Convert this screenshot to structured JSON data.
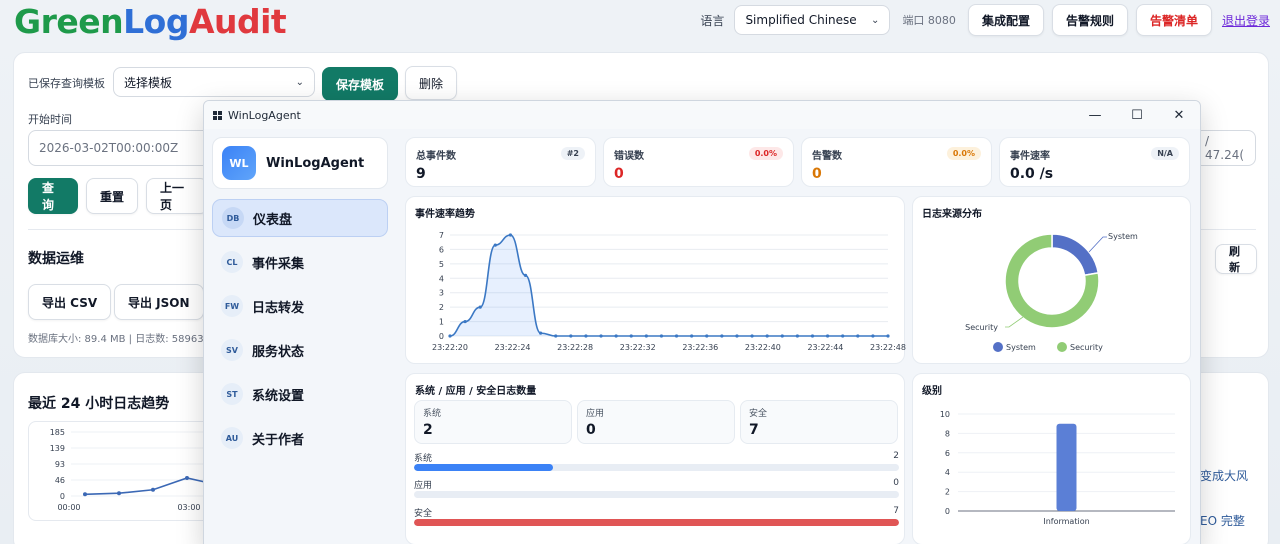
{
  "app": {
    "logo_part1": "Green",
    "logo_part2": "Log",
    "logo_part3": "Audit",
    "colors": {
      "green": "#1e9a4a",
      "blue": "#2f6fd6",
      "red": "#e0393e",
      "primary": "#127a66"
    }
  },
  "topbar": {
    "language_label": "语言",
    "language_value": "Simplified Chinese",
    "port": "端口 8080",
    "integration_button": "集成配置",
    "alert_rules_button": "告警规则",
    "alert_list_button": "告警清单",
    "logout_link": "退出登录"
  },
  "query_panel": {
    "saved_template_label": "已保存查询模板",
    "template_select": "选择模板",
    "save_template_button": "保存模板",
    "delete_button": "删除",
    "start_time_label": "开始时间",
    "start_time_value": "2026-03-02T00:00:00Z",
    "right_clip_value": "/ 47.24(",
    "query_button": "查询",
    "reset_button": "重置",
    "prev_button": "上一页"
  },
  "ops_panel": {
    "title": "数据运维",
    "export_csv_button": "导出 CSV",
    "export_json_button": "导出 JSON",
    "db_info": "数据库大小: 89.4 MB | 日志数: 58963",
    "refresh_button": "刷新"
  },
  "trend_panel": {
    "title": "最近 24 小时日志趋势",
    "y_ticks": [
      "185",
      "139",
      "93",
      "46",
      "0"
    ],
    "x_ticks": [
      "00:00",
      "03:00"
    ],
    "values": [
      5,
      8,
      18,
      52,
      30
    ],
    "right_text_1": "变成大风",
    "right_text_2": "EO 完整"
  },
  "window": {
    "title": "WinLogAgent",
    "minimize": "—",
    "maximize": "☐",
    "close": "✕"
  },
  "sidebar": {
    "brand_badge": "WL",
    "brand_name": "WinLogAgent",
    "items": [
      {
        "code": "DB",
        "label": "仪表盘",
        "active": true
      },
      {
        "code": "CL",
        "label": "事件采集"
      },
      {
        "code": "FW",
        "label": "日志转发"
      },
      {
        "code": "SV",
        "label": "服务状态"
      },
      {
        "code": "ST",
        "label": "系统设置"
      },
      {
        "code": "AU",
        "label": "关于作者"
      }
    ]
  },
  "stats": [
    {
      "title": "总事件数",
      "value": "9",
      "badge": "#2",
      "value_color": "#111827",
      "badge_bg": "#eef2f7",
      "badge_color": "#374151"
    },
    {
      "title": "错误数",
      "value": "0",
      "badge": "0.0%",
      "value_color": "#dc2626",
      "badge_bg": "#fde8e8",
      "badge_color": "#dc2626"
    },
    {
      "title": "告警数",
      "value": "0",
      "badge": "0.0%",
      "value_color": "#d97706",
      "badge_bg": "#fdf1dc",
      "badge_color": "#d97706"
    },
    {
      "title": "事件速率",
      "value": "0.0 /s",
      "badge": "N/A",
      "value_color": "#111827",
      "badge_bg": "#eef2f7",
      "badge_color": "#374151"
    }
  ],
  "rate_chart": {
    "title": "事件速率趋势",
    "chart_data": {
      "type": "line",
      "x_labels": [
        "23:22:20",
        "23:22:24",
        "23:22:28",
        "23:22:32",
        "23:22:36",
        "23:22:40",
        "23:22:44",
        "23:22:48"
      ],
      "y_ticks": [
        0,
        1,
        2,
        3,
        4,
        5,
        6,
        7
      ],
      "ylim": [
        0,
        7
      ],
      "values": [
        0,
        1.0,
        2.0,
        6.3,
        7.0,
        4.2,
        0.2,
        0,
        0,
        0,
        0,
        0,
        0,
        0,
        0,
        0,
        0,
        0,
        0,
        0,
        0,
        0,
        0,
        0,
        0,
        0,
        0,
        0,
        0,
        0
      ]
    }
  },
  "source_chart": {
    "title": "日志来源分布",
    "chart_data": {
      "type": "pie",
      "donut": true,
      "labels": [
        "System",
        "Security"
      ],
      "values": [
        2,
        7
      ],
      "colors": [
        "#5470c6",
        "#91cc75"
      ]
    }
  },
  "counts": {
    "title": "系统 / 应用 / 安全日志数量",
    "items": [
      {
        "label": "系统",
        "value": "2"
      },
      {
        "label": "应用",
        "value": "0"
      },
      {
        "label": "安全",
        "value": "7"
      }
    ],
    "bars": [
      {
        "label": "系统",
        "value": "2",
        "fraction": 0.286,
        "color": "#3b82f6"
      },
      {
        "label": "应用",
        "value": "0",
        "fraction": 0,
        "color": "#9ca3af"
      },
      {
        "label": "安全",
        "value": "7",
        "fraction": 1.0,
        "color": "#e05555"
      }
    ]
  },
  "level_chart": {
    "title": "级别",
    "chart_data": {
      "type": "bar",
      "categories": [
        "Information"
      ],
      "values": [
        9
      ],
      "ylim": [
        0,
        10
      ],
      "y_ticks": [
        0,
        2,
        4,
        6,
        8,
        10
      ],
      "color": "#5b7fd6"
    }
  }
}
